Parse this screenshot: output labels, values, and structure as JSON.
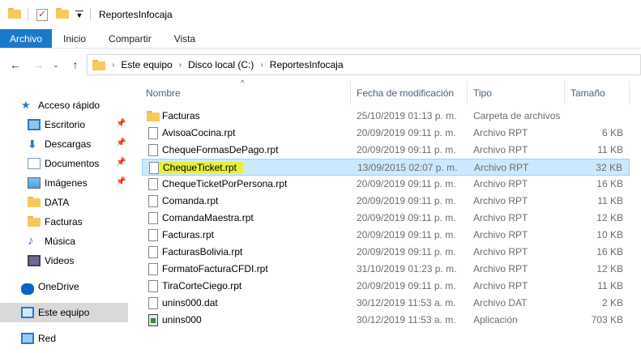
{
  "window": {
    "title": "ReportesInfocaja"
  },
  "ribbon": {
    "tabs": [
      "Archivo",
      "Inicio",
      "Compartir",
      "Vista"
    ]
  },
  "address": {
    "crumbs": [
      "Este equipo",
      "Disco local (C:)",
      "ReportesInfocaja"
    ]
  },
  "columns": {
    "name": "Nombre",
    "date": "Fecha de modificación",
    "type": "Tipo",
    "size": "Tamaño"
  },
  "nav": {
    "items": [
      {
        "label": "Acceso rápido",
        "icon": "star-icon"
      },
      {
        "label": "Escritorio",
        "icon": "desktop-icon",
        "pinned": true
      },
      {
        "label": "Descargas",
        "icon": "download-icon",
        "pinned": true
      },
      {
        "label": "Documentos",
        "icon": "documents-icon",
        "pinned": true
      },
      {
        "label": "Imágenes",
        "icon": "pictures-icon",
        "pinned": true
      },
      {
        "label": "DATA",
        "icon": "folder-icon"
      },
      {
        "label": "Facturas",
        "icon": "folder-icon"
      },
      {
        "label": "Música",
        "icon": "music-icon"
      },
      {
        "label": "Videos",
        "icon": "videos-icon"
      },
      {
        "label": "OneDrive",
        "icon": "onedrive-icon"
      },
      {
        "label": "Este equipo",
        "icon": "this-pc-icon",
        "selected": true
      },
      {
        "label": "Red",
        "icon": "network-icon"
      }
    ]
  },
  "files": [
    {
      "name": "Facturas",
      "date": "25/10/2019 01:13 p. m.",
      "type": "Carpeta de archivos",
      "size": "",
      "kind": "folder"
    },
    {
      "name": "AvisoaCocina.rpt",
      "date": "20/09/2019 09:11 p. m.",
      "type": "Archivo RPT",
      "size": "6 KB",
      "kind": "file"
    },
    {
      "name": "ChequeFormasDePago.rpt",
      "date": "20/09/2019 09:11 p. m.",
      "type": "Archivo RPT",
      "size": "11 KB",
      "kind": "file"
    },
    {
      "name": "ChequeTicket.rpt",
      "date": "13/09/2015 02:07 p. m.",
      "type": "Archivo RPT",
      "size": "32 KB",
      "kind": "file",
      "selected": true
    },
    {
      "name": "ChequeTicketPorPersona.rpt",
      "date": "20/09/2019 09:11 p. m.",
      "type": "Archivo RPT",
      "size": "16 KB",
      "kind": "file"
    },
    {
      "name": "Comanda.rpt",
      "date": "20/09/2019 09:11 p. m.",
      "type": "Archivo RPT",
      "size": "11 KB",
      "kind": "file"
    },
    {
      "name": "ComandaMaestra.rpt",
      "date": "20/09/2019 09:11 p. m.",
      "type": "Archivo RPT",
      "size": "12 KB",
      "kind": "file"
    },
    {
      "name": "Facturas.rpt",
      "date": "20/09/2019 09:11 p. m.",
      "type": "Archivo RPT",
      "size": "10 KB",
      "kind": "file"
    },
    {
      "name": "FacturasBolivia.rpt",
      "date": "20/09/2019 09:11 p. m.",
      "type": "Archivo RPT",
      "size": "16 KB",
      "kind": "file"
    },
    {
      "name": "FormatoFacturaCFDI.rpt",
      "date": "31/10/2019 01:23 p. m.",
      "type": "Archivo RPT",
      "size": "12 KB",
      "kind": "file"
    },
    {
      "name": "TiraCorteCiego.rpt",
      "date": "20/09/2019 09:11 p. m.",
      "type": "Archivo RPT",
      "size": "11 KB",
      "kind": "file"
    },
    {
      "name": "unins000.dat",
      "date": "30/12/2019 11:53 a. m.",
      "type": "Archivo DAT",
      "size": "2 KB",
      "kind": "file"
    },
    {
      "name": "unins000",
      "date": "30/12/2019 11:53 a. m.",
      "type": "Aplicación",
      "size": "703 KB",
      "kind": "app"
    }
  ]
}
